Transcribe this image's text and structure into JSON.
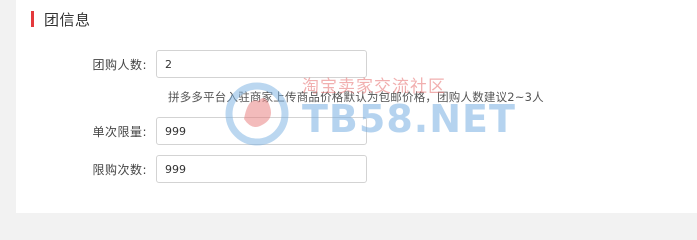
{
  "section": {
    "title": "团信息"
  },
  "form": {
    "group_size": {
      "label": "团购人数:",
      "value": "2",
      "hint": "拼多多平台入驻商家上传商品价格默认为包邮价格，团购人数建议2~3人"
    },
    "single_limit": {
      "label": "单次限量:",
      "value": "999"
    },
    "purchase_limit": {
      "label": "限购次数:",
      "value": "999"
    }
  },
  "watermark": {
    "cn": "淘宝卖家交流社区",
    "en": "TB58.NET"
  },
  "colors": {
    "accent": "#e4393c",
    "input_border": "#d3d3d3",
    "background": "#f2f2f2",
    "panel": "#ffffff"
  }
}
